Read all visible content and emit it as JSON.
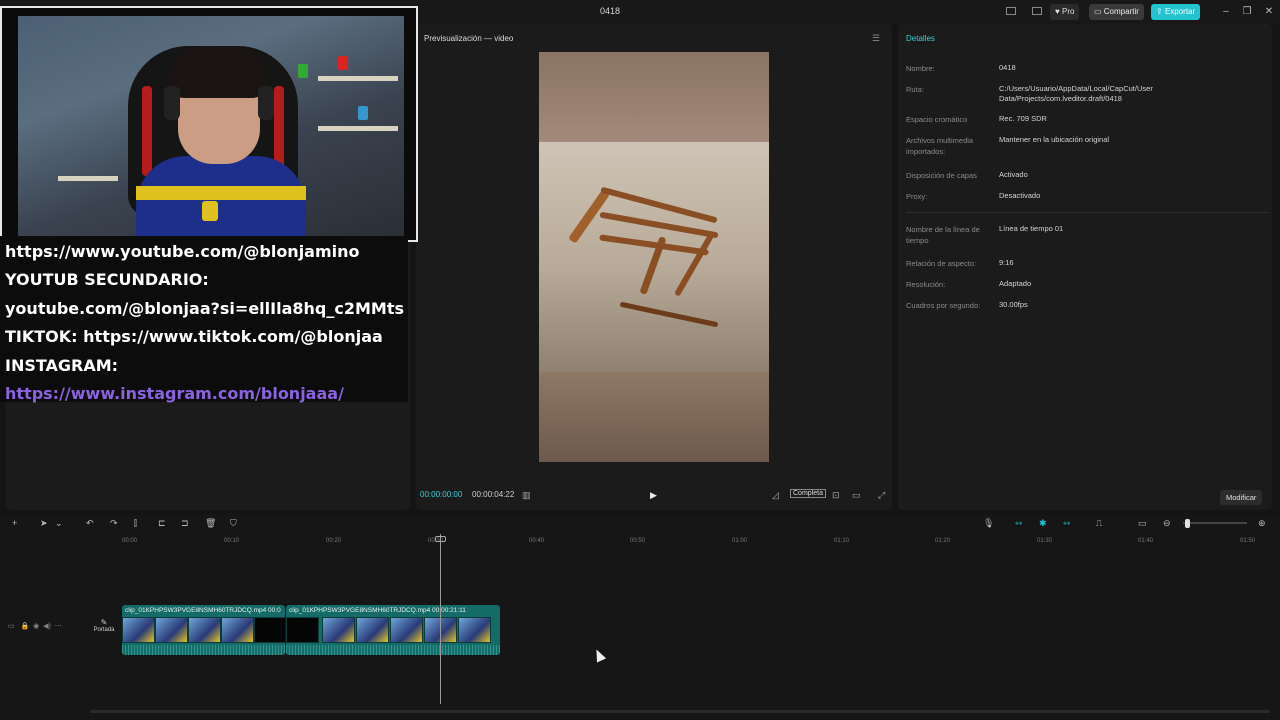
{
  "app": {
    "title": "0418"
  },
  "titlebar": {
    "pro": "Pro",
    "share": "Compartir",
    "export": "Exportar"
  },
  "preview": {
    "title": "Previsualización — video",
    "current_time": "00:00:00:00",
    "total_time": "00:00:04:22",
    "fit_label": "Completa"
  },
  "overlay": {
    "lines": [
      "https://www.youtube.com/@blonjamino",
      "YOUTUB SECUNDARIO:",
      "youtube.com/@blonjaa?si=ellIla8hq_c2MMts",
      "TIKTOK: https://www.tiktok.com/@blonjaa",
      "INSTAGRAM:",
      "https://www.instagram.com/blonjaaa/"
    ]
  },
  "details": {
    "title": "Detalles",
    "rows": [
      {
        "label": "Nombre:",
        "value": "0418"
      },
      {
        "label": "Ruta:",
        "value": "C:/Users/Usuario/AppData/Local/CapCut/User Data/Projects/com.lveditor.draft/0418"
      },
      {
        "label": "Espacio cromático",
        "value": "Rec. 709 SDR"
      },
      {
        "label": "Archivos multimedia importados:",
        "value": "Mantener en la ubicación original"
      },
      {
        "label": "Disposición de capas",
        "value": "Activado"
      },
      {
        "label": "Proxy:",
        "value": "Desactivado"
      },
      {
        "label": "Nombre de la línea de tiempo",
        "value": "Línea de tiempo 01"
      },
      {
        "label": "Relación de aspecto:",
        "value": "9:16"
      },
      {
        "label": "Resolución:",
        "value": "Adaptado"
      },
      {
        "label": "Cuadros por segundo:",
        "value": "30.00fps"
      }
    ],
    "modify_label": "Modificar"
  },
  "timeline": {
    "ticks": [
      "00:00",
      "00:10",
      "00:20",
      "00:30",
      "00:40",
      "00:50",
      "01:00",
      "01:10",
      "01:20",
      "01:30",
      "01:40",
      "01:50"
    ],
    "cover_label": "Portada",
    "clips": [
      {
        "name": "clip_01KPHPSW3PVGE8NSMH60TRJDCQ.mp4   00:0"
      },
      {
        "name": "clip_01KPHPSW3PVGE8NSMH60TRJDCQ.mp4   00:00:21:11"
      }
    ]
  },
  "colors": {
    "accent": "#21c4cf",
    "clip": "#146b67",
    "link": "#8a63e0"
  }
}
